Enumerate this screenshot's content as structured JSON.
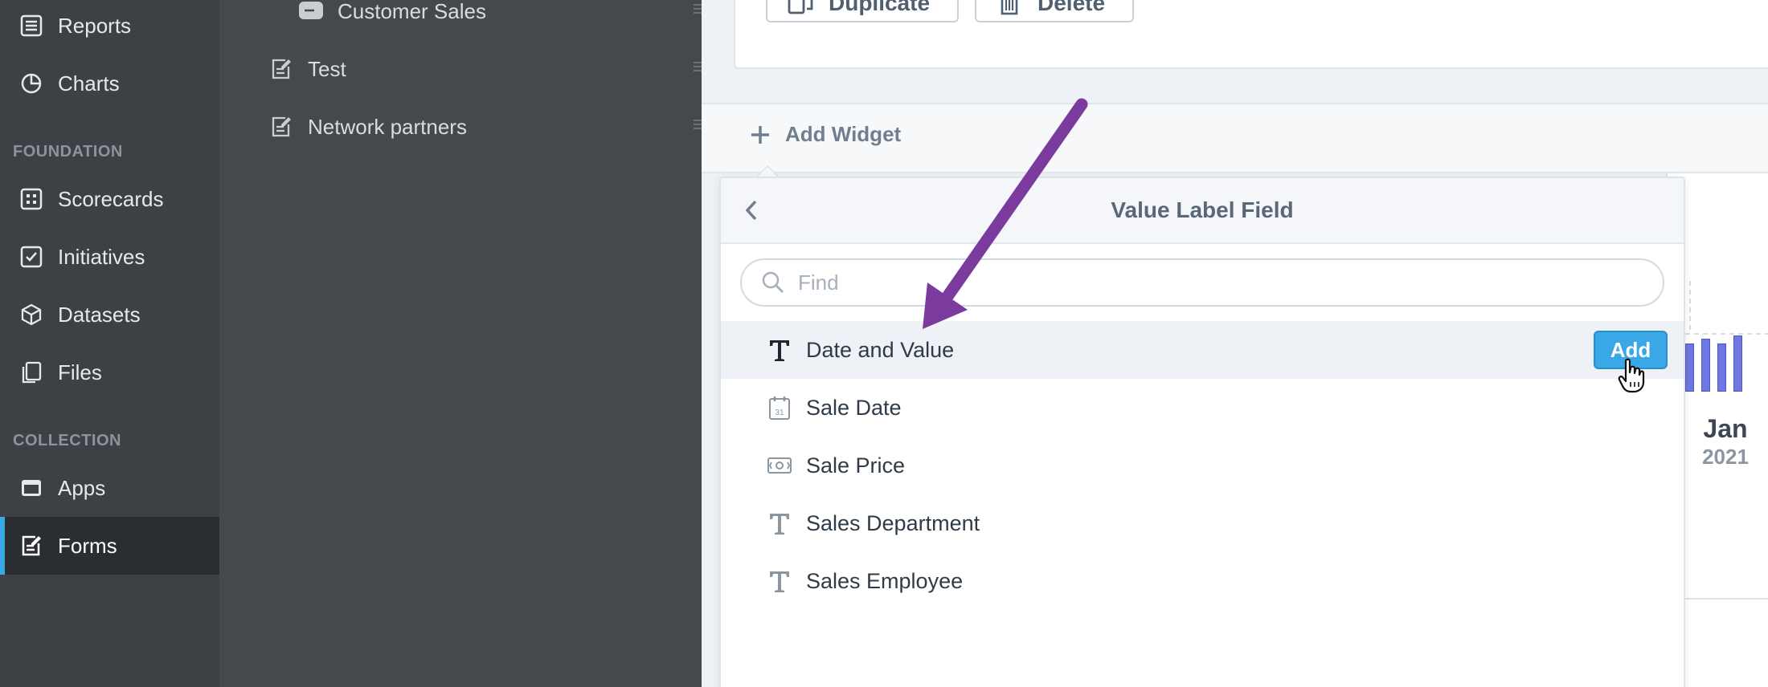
{
  "nav": {
    "items": [
      {
        "label": "Reports",
        "icon": "reports-icon"
      },
      {
        "label": "Charts",
        "icon": "pie-chart-icon"
      },
      {
        "label": "Scorecards",
        "icon": "scorecard-icon"
      },
      {
        "label": "Initiatives",
        "icon": "checkbox-icon"
      },
      {
        "label": "Datasets",
        "icon": "cube-icon"
      },
      {
        "label": "Files",
        "icon": "files-icon"
      },
      {
        "label": "Apps",
        "icon": "app-window-icon"
      },
      {
        "label": "Forms",
        "icon": "form-icon"
      }
    ],
    "sections": [
      "FOUNDATION",
      "COLLECTION"
    ],
    "active": "Forms"
  },
  "subnav": {
    "items": [
      {
        "label": "Customer Sales",
        "icon": "message-icon"
      },
      {
        "label": "Test",
        "icon": "form-icon"
      },
      {
        "label": "Network partners",
        "icon": "form-icon"
      }
    ]
  },
  "toolbar": {
    "duplicate_label": "Duplicate",
    "delete_label": "Delete"
  },
  "widget_bar": {
    "add_label": "Add Widget"
  },
  "dropdown": {
    "title": "Value Label Field",
    "search_placeholder": "Find",
    "search_value": "",
    "fields": [
      {
        "label": "Date and Value",
        "type": "text",
        "icon": "text-type-icon",
        "highlighted": true
      },
      {
        "label": "Sale Date",
        "type": "date",
        "icon": "calendar-icon",
        "highlighted": false
      },
      {
        "label": "Sale Price",
        "type": "currency",
        "icon": "money-icon",
        "highlighted": false
      },
      {
        "label": "Sales Department",
        "type": "text",
        "icon": "text-type-icon",
        "highlighted": false
      },
      {
        "label": "Sales Employee",
        "type": "text",
        "icon": "text-type-icon",
        "highlighted": false
      }
    ],
    "add_label": "Add"
  },
  "chart_preview": {
    "month": "Jan",
    "year": "2021",
    "bar_color": "#6f78e0"
  },
  "colors": {
    "accent": "#3aa7e6",
    "annotation_arrow": "#7b3a9e"
  }
}
